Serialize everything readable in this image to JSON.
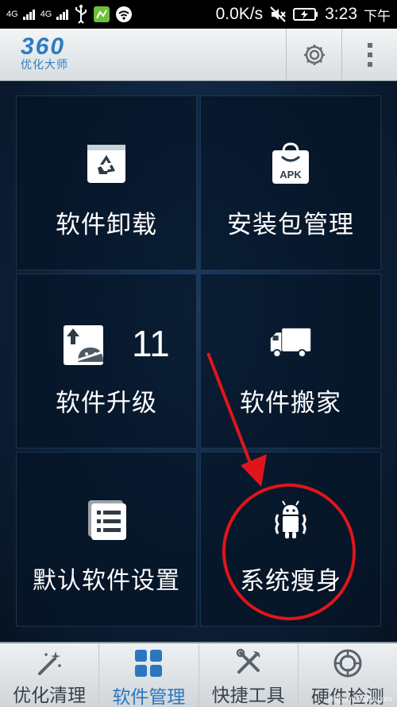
{
  "status_bar": {
    "network_1": "4G",
    "network_2": "4G",
    "speed": "0.0K/s",
    "time": "3:23",
    "ampm": "下午"
  },
  "header": {
    "logo_number": "360",
    "logo_text": "优化大师",
    "settings_icon": "gear-icon",
    "more_icon": "vertical-dots-icon"
  },
  "tiles": [
    {
      "label": "软件卸载",
      "icon": "recycle-icon"
    },
    {
      "label": "安装包管理",
      "icon": "apk-bag-icon",
      "icon_text": "APK"
    },
    {
      "label": "软件升级",
      "icon": "android-upgrade-icon",
      "badge": "11"
    },
    {
      "label": "软件搬家",
      "icon": "truck-icon"
    },
    {
      "label": "默认软件设置",
      "icon": "list-icon"
    },
    {
      "label": "系统瘦身",
      "icon": "android-slim-icon"
    }
  ],
  "nav": [
    {
      "label": "优化清理",
      "icon": "magic-wand-icon",
      "active": false
    },
    {
      "label": "软件管理",
      "icon": "grid-icon",
      "active": true
    },
    {
      "label": "快捷工具",
      "icon": "tools-icon",
      "active": false
    },
    {
      "label": "硬件检测",
      "icon": "target-icon",
      "active": false
    }
  ],
  "colors": {
    "accent": "#2a77c0",
    "annotation": "#e0151b",
    "panel_bg": "#0d2038"
  },
  "watermark": "jingyan.baidu.com"
}
